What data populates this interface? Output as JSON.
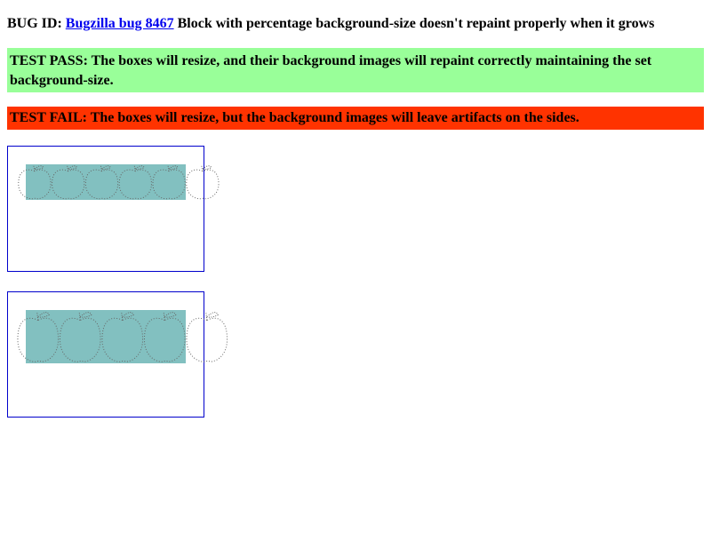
{
  "bug": {
    "prefix": "BUG ID: ",
    "link_text": "Bugzilla bug 8467",
    "description": " Block with percentage background-size doesn't repaint properly when it grows"
  },
  "pass": {
    "label": "TEST PASS: ",
    "text": "The boxes will resize, and their background images will repaint correctly maintaining the set background-size.",
    "color": "#99ff99"
  },
  "fail": {
    "label": "TEST FAIL: ",
    "text": "The boxes will resize, but the background images will leave artifacts on the sides.",
    "color": "#ff3300"
  },
  "boxes": [
    {
      "apple_count": 5
    },
    {
      "apple_count": 4
    }
  ],
  "colors": {
    "band": "#82c0c0",
    "apple_outline": "#666666",
    "box_border": "#0000cc",
    "link": "#0000ee"
  }
}
